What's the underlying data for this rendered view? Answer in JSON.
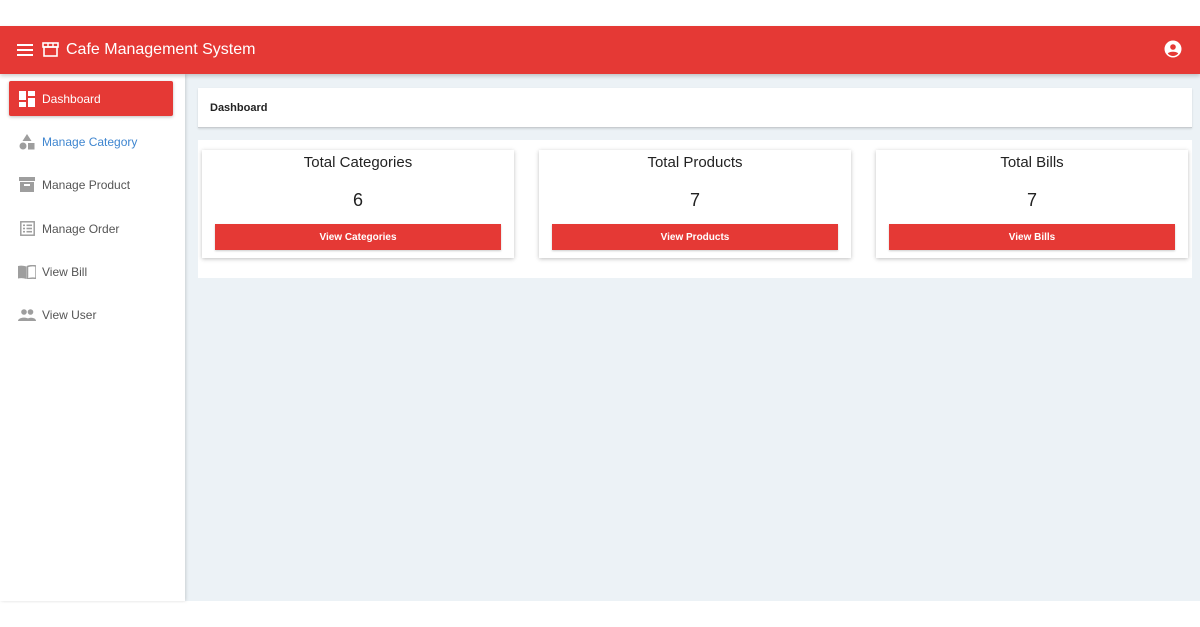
{
  "app": {
    "title": "Cafe Management System",
    "accent_color": "#e53935",
    "menu_icon": "menu-icon",
    "brand_icon": "storefront-icon",
    "account_icon": "account-circle-icon"
  },
  "sidebar": {
    "items": [
      {
        "label": "Dashboard",
        "icon": "dashboard-icon",
        "active": true
      },
      {
        "label": "Manage Category",
        "icon": "category-icon",
        "active": false
      },
      {
        "label": "Manage Product",
        "icon": "inventory-icon",
        "active": false
      },
      {
        "label": "Manage Order",
        "icon": "list-alt-icon",
        "active": false
      },
      {
        "label": "View Bill",
        "icon": "import-contacts-icon",
        "active": false
      },
      {
        "label": "View User",
        "icon": "people-icon",
        "active": false
      }
    ]
  },
  "breadcrumb": {
    "label": "Dashboard"
  },
  "cards": [
    {
      "title": "Total Categories",
      "value": "6",
      "button": "View Categories"
    },
    {
      "title": "Total Products",
      "value": "7",
      "button": "View Products"
    },
    {
      "title": "Total Bills",
      "value": "7",
      "button": "View Bills"
    }
  ]
}
